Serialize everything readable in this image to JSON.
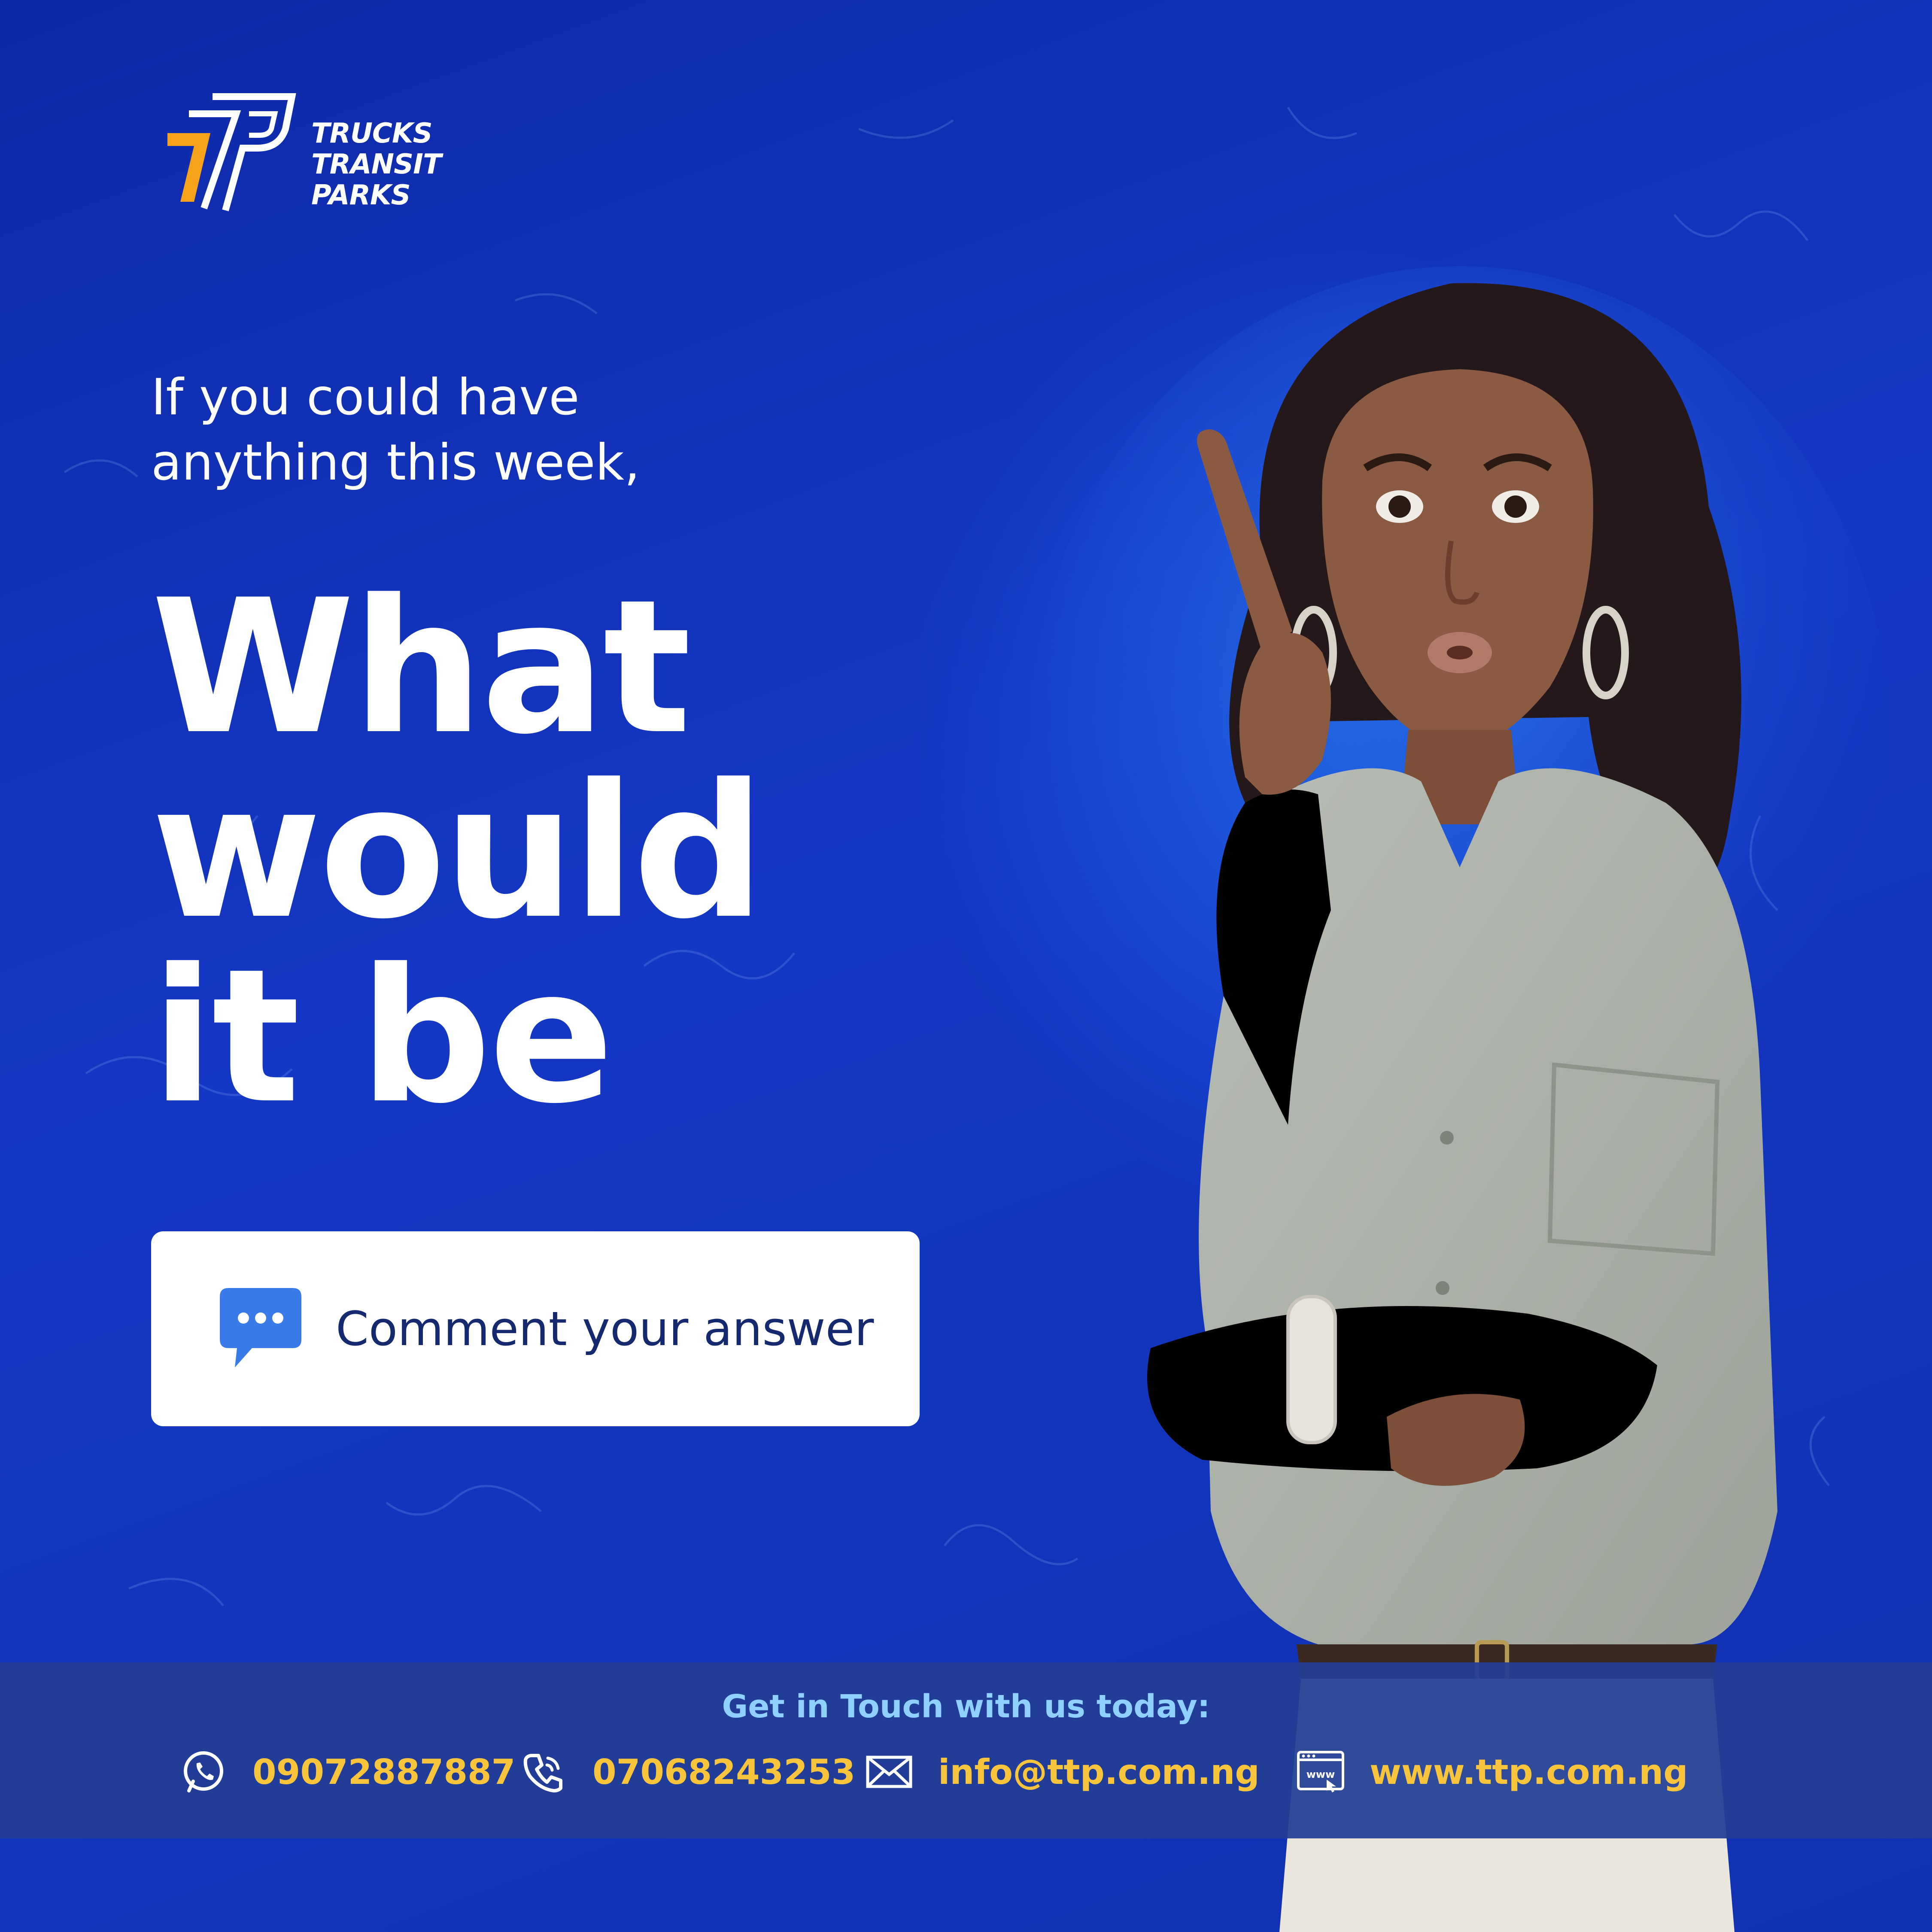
{
  "brand": {
    "name_lines": [
      "TRUCKS",
      "TRANSIT",
      "PARKS"
    ],
    "accent_color": "#f7a21b",
    "background_color": "#1437c4"
  },
  "intro_lines": [
    "If you could have",
    "anything this week,"
  ],
  "headline_lines": [
    "What",
    "would",
    "it be"
  ],
  "cta": {
    "icon": "chat-bubble-icon",
    "label": "Comment your answer"
  },
  "contact": {
    "heading": "Get in Touch with us today:",
    "items": [
      {
        "icon": "whatsapp-icon",
        "value": "09072887887"
      },
      {
        "icon": "phone-icon",
        "value": "07068243253"
      },
      {
        "icon": "envelope-icon",
        "value": "info@ttp.com.ng"
      },
      {
        "icon": "website-icon",
        "value": "www.ttp.com.ng"
      }
    ],
    "value_color": "#f7c43c",
    "heading_color": "#8fd0ff"
  }
}
